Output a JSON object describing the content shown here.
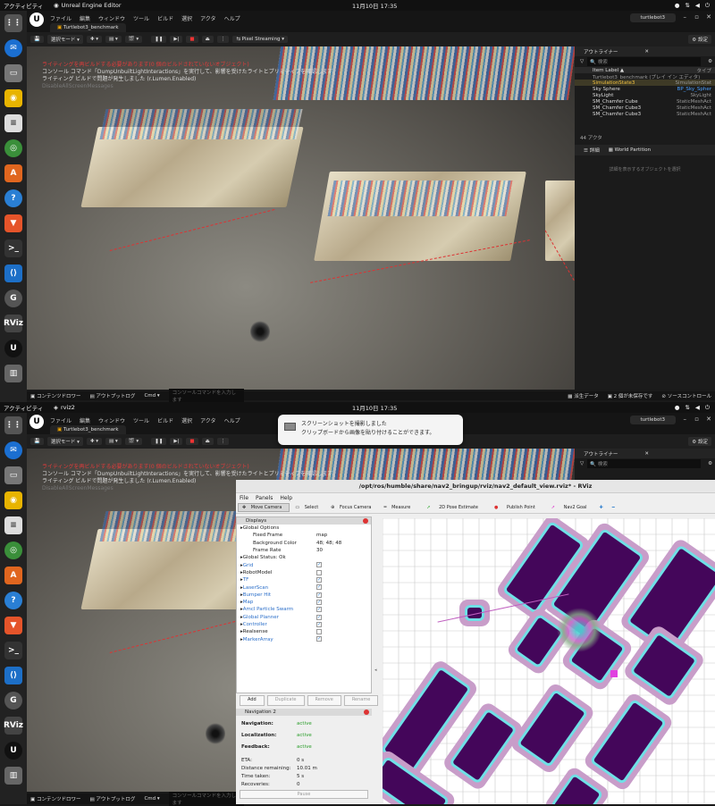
{
  "top1": {
    "activities": "アクティビティ",
    "app": "Unreal Engine Editor",
    "clock": "11月10日  17:35"
  },
  "top2": {
    "activities": "アクティビティ",
    "app": "rviz2",
    "clock": "11月10日  17:35"
  },
  "ue": {
    "menus": [
      "ファイル",
      "編集",
      "ウィンドウ",
      "ツール",
      "ビルド",
      "選択",
      "アクタ",
      "ヘルプ"
    ],
    "tab": "Turtlebot3_benchmark",
    "project": "turtlebot3",
    "select_mode": "選択モード",
    "pixel_streaming": "Pixel Streaming",
    "settings": "設定"
  },
  "viewport": {
    "warn1": "ライティングを再ビルドする必要があります(0 個のビルドされていないオブジェクト)",
    "warn2": "コンソール コマンド「DumpUnbuiltLightInteractions」を実行して、影響を受けたライトとプリミティブを確認します",
    "warn3": "ライティング ビルドで問題が発生しました (r.Lumen.Enabled)",
    "warn4": "DisableAllScreenMessages"
  },
  "outliner": {
    "title": "アウトライナー",
    "search": "検索",
    "col_label": "Item Label ▲",
    "col_type": "タイプ",
    "rows": [
      {
        "n": "Turtlebot3_benchmark (プレイ イン エディタ)",
        "t": ""
      },
      {
        "n": "SimulationState3",
        "t": "SimulationStat"
      },
      {
        "n": "Sky Sphere",
        "t": "BP_Sky_Spher"
      },
      {
        "n": "SkyLight",
        "t": "SkyLight"
      },
      {
        "n": "SM_Chamfer Cube",
        "t": "StaticMeshAct"
      },
      {
        "n": "SM_Chamfer Cube3",
        "t": "StaticMeshAct"
      },
      {
        "n": "SM_Chamfer Cube3",
        "t": "StaticMeshAct"
      }
    ],
    "actors": "44 アクタ",
    "details": "詳細",
    "world_partition": "World Partition",
    "empty": "詳細を表示するオブジェクトを選択"
  },
  "status": {
    "content_drawer": "コンテンツドロワー",
    "output_log": "アウトプットログ",
    "cmd": "Cmd",
    "cmd_placeholder": "コンソールコマンドを入力します",
    "derived": "派生データ",
    "unsaved": "2 個が未保存です",
    "source": "ソースコントロール"
  },
  "notification": {
    "line1": "スクリーンショットを撮影しました",
    "line2": "クリップボードから画像を貼り付けることができます。"
  },
  "rviz": {
    "title": "/opt/ros/humble/share/nav2_bringup/rviz/nav2_default_view.rviz* - RViz",
    "menus": [
      "File",
      "Panels",
      "Help"
    ],
    "tools": [
      "Move Camera",
      "Select",
      "Focus Camera",
      "Measure",
      "2D Pose Estimate",
      "Publish Point",
      "Nav2 Goal"
    ],
    "displays_title": "Displays",
    "displays": [
      {
        "label": "Global Options",
        "val": "",
        "ind": 0,
        "blue": false,
        "cb": false
      },
      {
        "label": "Fixed Frame",
        "val": "map",
        "ind": 1,
        "blue": false,
        "cb": false
      },
      {
        "label": "Background Color",
        "val": "48; 48; 48",
        "ind": 1,
        "blue": false,
        "cb": false
      },
      {
        "label": "Frame Rate",
        "val": "30",
        "ind": 1,
        "blue": false,
        "cb": false
      },
      {
        "label": "Global Status: Ok",
        "val": "",
        "ind": 0,
        "blue": false,
        "cb": false
      },
      {
        "label": "Grid",
        "val": "",
        "ind": 0,
        "blue": true,
        "cb": true
      },
      {
        "label": "RobotModel",
        "val": "",
        "ind": 0,
        "blue": false,
        "cb": false
      },
      {
        "label": "TF",
        "val": "",
        "ind": 0,
        "blue": true,
        "cb": true
      },
      {
        "label": "LaserScan",
        "val": "",
        "ind": 0,
        "blue": true,
        "cb": true
      },
      {
        "label": "Bumper Hit",
        "val": "",
        "ind": 0,
        "blue": true,
        "cb": true
      },
      {
        "label": "Map",
        "val": "",
        "ind": 0,
        "blue": true,
        "cb": true
      },
      {
        "label": "Amcl Particle Swarm",
        "val": "",
        "ind": 0,
        "blue": true,
        "cb": true
      },
      {
        "label": "Global Planner",
        "val": "",
        "ind": 0,
        "blue": true,
        "cb": true
      },
      {
        "label": "Controller",
        "val": "",
        "ind": 0,
        "blue": true,
        "cb": true
      },
      {
        "label": "Realsense",
        "val": "",
        "ind": 0,
        "blue": false,
        "cb": false
      },
      {
        "label": "MarkerArray",
        "val": "",
        "ind": 0,
        "blue": true,
        "cb": true
      }
    ],
    "buttons": [
      "Add",
      "Duplicate",
      "Remove",
      "Rename"
    ],
    "nav2_title": "Navigation 2",
    "nav2": [
      {
        "k": "Navigation:",
        "v": "active"
      },
      {
        "k": "Localization:",
        "v": "active"
      },
      {
        "k": "Feedback:",
        "v": "active"
      }
    ],
    "nav2_stats": [
      {
        "k": "ETA:",
        "v": "0 s"
      },
      {
        "k": "Distance remaining:",
        "v": "10.01 m"
      },
      {
        "k": "Time taken:",
        "v": "5 s"
      },
      {
        "k": "Recoveries:",
        "v": "0"
      }
    ],
    "pause": "Pause"
  }
}
